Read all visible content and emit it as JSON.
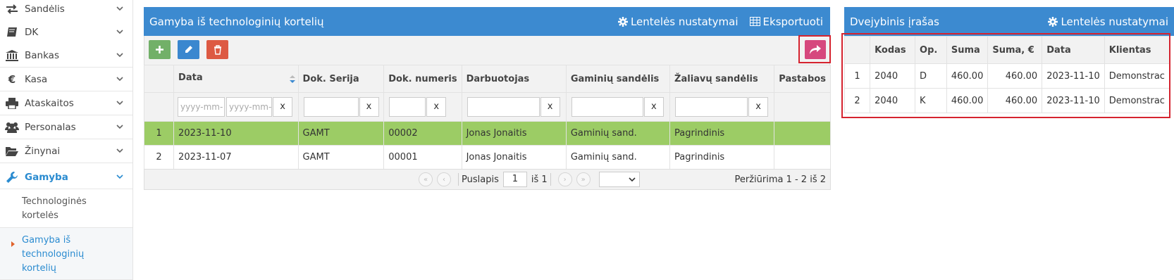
{
  "sidebar": {
    "items": [
      {
        "label": "Sandėlis",
        "icon": "arrows-exchange-icon"
      },
      {
        "label": "DK",
        "icon": "book-icon"
      },
      {
        "label": "Bankas",
        "icon": "bank-icon"
      },
      {
        "label": "Kasa",
        "icon": "euro-icon"
      },
      {
        "label": "Ataskaitos",
        "icon": "printer-icon"
      },
      {
        "label": "Personalas",
        "icon": "users-icon"
      },
      {
        "label": "Žinynai",
        "icon": "folder-open-icon"
      },
      {
        "label": "Gamyba",
        "icon": "wrench-icon"
      }
    ],
    "subitems": [
      {
        "label": "Technologinės kortelės"
      },
      {
        "label": "Gamyba iš technologinių kortelių"
      }
    ]
  },
  "main_panel": {
    "title": "Gamyba iš technologinių kortelių",
    "settings_label": "Lentelės nustatymai",
    "export_label": "Eksportuoti",
    "columns": [
      "Data",
      "Dok. Serija",
      "Dok. numeris",
      "Darbuotojas",
      "Gaminių sandėlis",
      "Žaliavų sandėlis",
      "Pastabos"
    ],
    "date_placeholder": "yyyy-mm-",
    "clear_label": "x",
    "rows": [
      {
        "num": "1",
        "data": "2023-11-10",
        "serija": "GAMT",
        "numeris": "00002",
        "darbuotojas": "Jonas Jonaitis",
        "gaminiu": "Gaminių sand.",
        "zaliavu": "Pagrindinis",
        "pastabos": ""
      },
      {
        "num": "2",
        "data": "2023-11-07",
        "serija": "GAMT",
        "numeris": "00001",
        "darbuotojas": "Jonas Jonaitis",
        "gaminiu": "Gaminių sand.",
        "zaliavu": "Pagrindinis",
        "pastabos": ""
      }
    ],
    "pager": {
      "page_label": "Puslapis",
      "page_value": "1",
      "of_label": "iš 1",
      "summary": "Peržiūrima 1 - 2 iš 2"
    }
  },
  "side_panel": {
    "title": "Dvejybinis įrašas",
    "settings_label": "Lentelės nustatymai",
    "columns": [
      "Kodas",
      "Op.",
      "Suma",
      "Suma, €",
      "Data",
      "Klientas"
    ],
    "rows": [
      {
        "num": "1",
        "kodas": "2040",
        "op": "D",
        "suma": "460.00",
        "suma_eur": "460.00",
        "data": "2023-11-10",
        "klientas": "Demonstrac"
      },
      {
        "num": "2",
        "kodas": "2040",
        "op": "K",
        "suma": "460.00",
        "suma_eur": "460.00",
        "data": "2023-11-10",
        "klientas": "Demonstrac"
      }
    ]
  },
  "colors": {
    "header_blue": "#3c8ad0",
    "selected_row": "#9ccc65",
    "add_green": "#72b068",
    "edit_blue": "#3a87cf",
    "delete_red": "#dd5a43",
    "share_pink": "#d6487e",
    "highlight_red": "#d5232f"
  }
}
